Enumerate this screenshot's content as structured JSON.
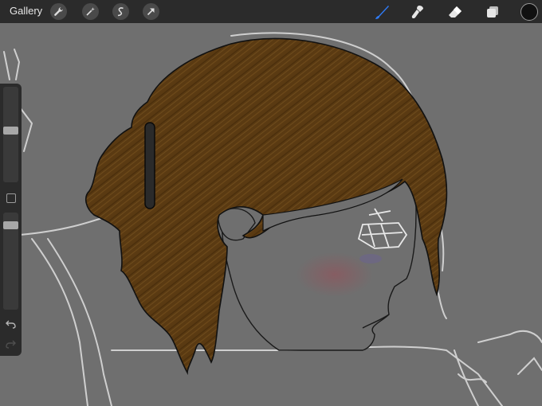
{
  "topbar": {
    "gallery_label": "Gallery",
    "left_tools": [
      {
        "name": "wrench-icon"
      },
      {
        "name": "magic-wand-icon"
      },
      {
        "name": "selection-icon"
      },
      {
        "name": "transform-arrow-icon"
      }
    ],
    "right_tools": [
      {
        "name": "brush-icon",
        "active": true
      },
      {
        "name": "smudge-icon"
      },
      {
        "name": "eraser-icon"
      },
      {
        "name": "layers-icon"
      }
    ],
    "current_color": "#111111"
  },
  "sidebar": {
    "brush_size_level": 0.55,
    "opacity_level": 0.9,
    "undo_icon": "undo-icon",
    "redo_icon": "redo-icon"
  },
  "colors": {
    "ui_dark": "#2b2b2b",
    "canvas_bg": "#6f6f6f",
    "hair": "#5a3a12",
    "brush_blue": "#2f7bf6"
  }
}
